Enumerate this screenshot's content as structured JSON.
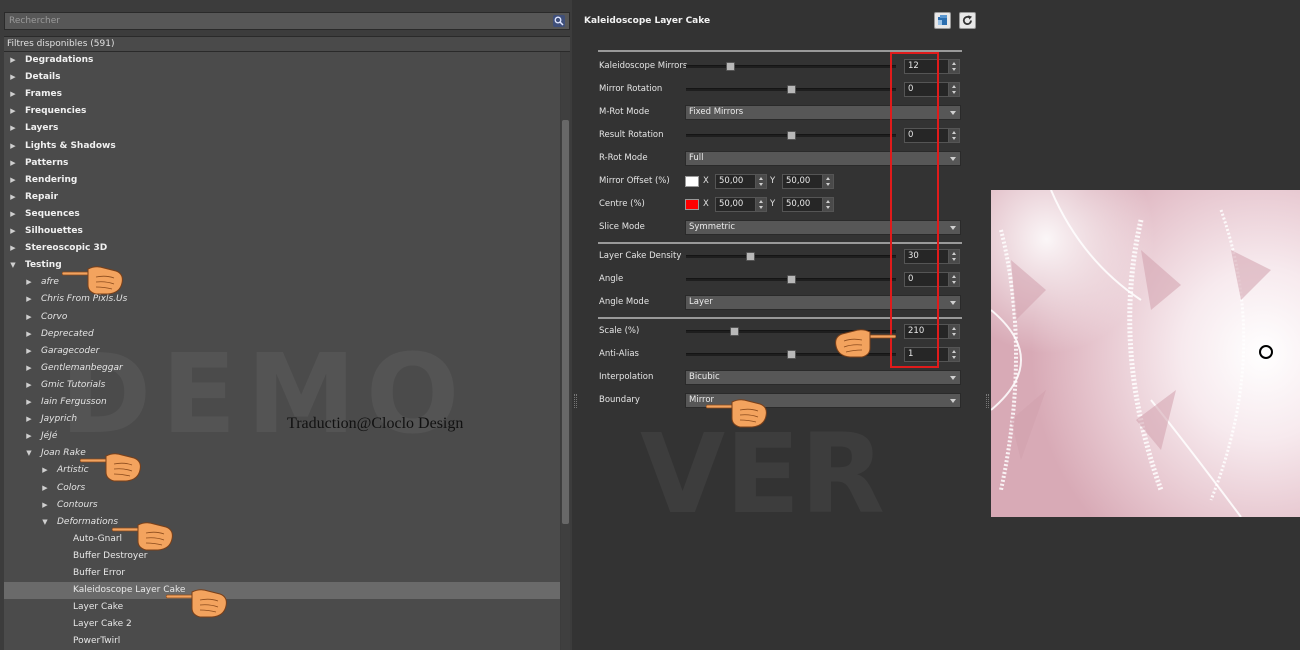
{
  "search": {
    "placeholder": "Rechercher"
  },
  "tree": {
    "header": "Filtres disponibles (591)",
    "items": [
      {
        "label": "Degradations",
        "level": 0,
        "expanded": false
      },
      {
        "label": "Details",
        "level": 0,
        "expanded": false
      },
      {
        "label": "Frames",
        "level": 0,
        "expanded": false
      },
      {
        "label": "Frequencies",
        "level": 0,
        "expanded": false
      },
      {
        "label": "Layers",
        "level": 0,
        "expanded": false
      },
      {
        "label": "Lights & Shadows",
        "level": 0,
        "expanded": false
      },
      {
        "label": "Patterns",
        "level": 0,
        "expanded": false
      },
      {
        "label": "Rendering",
        "level": 0,
        "expanded": false
      },
      {
        "label": "Repair",
        "level": 0,
        "expanded": false
      },
      {
        "label": "Sequences",
        "level": 0,
        "expanded": false
      },
      {
        "label": "Silhouettes",
        "level": 0,
        "expanded": false
      },
      {
        "label": "Stereoscopic 3D",
        "level": 0,
        "expanded": false
      },
      {
        "label": "Testing",
        "level": 0,
        "expanded": true
      },
      {
        "label": "afre",
        "level": 1,
        "expanded": false
      },
      {
        "label": "Chris From Pixls.Us",
        "level": 1,
        "expanded": false
      },
      {
        "label": "Corvo",
        "level": 1,
        "expanded": false
      },
      {
        "label": "Deprecated",
        "level": 1,
        "expanded": false
      },
      {
        "label": "Garagecoder",
        "level": 1,
        "expanded": false
      },
      {
        "label": "Gentlemanbeggar",
        "level": 1,
        "expanded": false
      },
      {
        "label": "Gmic Tutorials",
        "level": 1,
        "expanded": false
      },
      {
        "label": "Iain Fergusson",
        "level": 1,
        "expanded": false
      },
      {
        "label": "Jayprich",
        "level": 1,
        "expanded": false
      },
      {
        "label": "JéJé",
        "level": 1,
        "expanded": false
      },
      {
        "label": "Joan Rake",
        "level": 1,
        "expanded": true
      },
      {
        "label": "Artistic",
        "level": 2,
        "expanded": false
      },
      {
        "label": "Colors",
        "level": 2,
        "expanded": false
      },
      {
        "label": "Contours",
        "level": 2,
        "expanded": false
      },
      {
        "label": "Deformations",
        "level": 2,
        "expanded": true
      },
      {
        "label": "Auto-Gnarl",
        "level": 3
      },
      {
        "label": "Buffer Destroyer",
        "level": 3
      },
      {
        "label": "Buffer Error",
        "level": 3
      },
      {
        "label": "Kaleidoscope Layer Cake",
        "level": 3,
        "selected": true
      },
      {
        "label": "Layer Cake",
        "level": 3
      },
      {
        "label": "Layer Cake 2",
        "level": 3
      },
      {
        "label": "PowerTwirl",
        "level": 3
      }
    ]
  },
  "watermark": {
    "left": "DEMO",
    "right": "VER"
  },
  "credit": "Traduction@Cloclo Design",
  "filter": {
    "title": "Kaleidoscope Layer Cake",
    "params": [
      {
        "kind": "slider",
        "label": "Kaleidoscope Mirrors",
        "value": "12",
        "fraction": 0.2
      },
      {
        "kind": "slider",
        "label": "Mirror Rotation",
        "value": "0",
        "fraction": 0.5
      },
      {
        "kind": "combo",
        "label": "M-Rot Mode",
        "value": "Fixed Mirrors"
      },
      {
        "kind": "slider",
        "label": "Result Rotation",
        "value": "0",
        "fraction": 0.5
      },
      {
        "kind": "combo",
        "label": "R-Rot Mode",
        "value": "Full"
      },
      {
        "kind": "point",
        "label": "Mirror Offset (%)",
        "swatch": "#ffffff",
        "x": "50,00",
        "y": "50,00",
        "x_label": "X",
        "y_label": "Y"
      },
      {
        "kind": "point",
        "label": "Centre (%)",
        "swatch": "#ff0000",
        "x": "50,00",
        "y": "50,00",
        "x_label": "X",
        "y_label": "Y"
      },
      {
        "kind": "combo",
        "label": "Slice Mode",
        "value": "Symmetric"
      },
      {
        "kind": "separator"
      },
      {
        "kind": "slider",
        "label": "Layer Cake Density",
        "value": "30",
        "fraction": 0.3
      },
      {
        "kind": "slider",
        "label": "Angle",
        "value": "0",
        "fraction": 0.5
      },
      {
        "kind": "combo",
        "label": "Angle Mode",
        "value": "Layer"
      },
      {
        "kind": "separator"
      },
      {
        "kind": "slider",
        "label": "Scale (%)",
        "value": "210",
        "fraction": 0.22
      },
      {
        "kind": "slider",
        "label": "Anti-Alias",
        "value": "1",
        "fraction": 0.5
      },
      {
        "kind": "combo",
        "label": "Interpolation",
        "value": "Bicubic"
      },
      {
        "kind": "combo",
        "label": "Boundary",
        "value": "Mirror"
      }
    ]
  },
  "colors": {
    "panel": "#3c3c3c",
    "tree_bg": "#4b4b4b",
    "highlight": "#e01b1b",
    "preview_tint": "#e9cdd5"
  }
}
